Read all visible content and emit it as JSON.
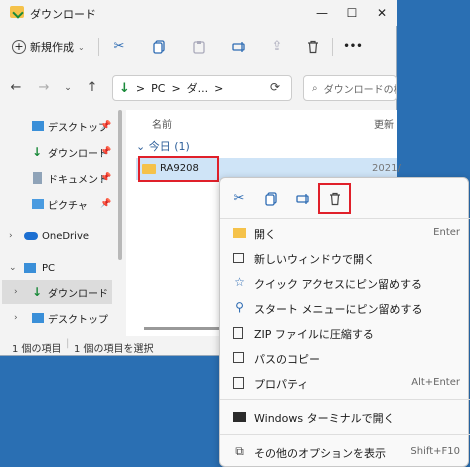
{
  "window": {
    "title": "ダウンロード",
    "controls": {
      "minimize": "—",
      "maximize": "☐",
      "close": "✕"
    }
  },
  "commandbar": {
    "new_label": "新規作成",
    "more": "•••"
  },
  "address": {
    "segments": [
      "PC",
      "ダ..."
    ],
    "sep": ">",
    "search_placeholder": "ダウンロードの検"
  },
  "sidebar": {
    "items": [
      {
        "label": "デスクトップ"
      },
      {
        "label": "ダウンロード"
      },
      {
        "label": "ドキュメント"
      },
      {
        "label": "ピクチャ"
      },
      {
        "label": "OneDrive"
      },
      {
        "label": "PC"
      },
      {
        "label": "ダウンロード"
      },
      {
        "label": "デスクトップ"
      }
    ]
  },
  "content": {
    "col_name": "名前",
    "col_date": "更新",
    "group": "今日 (1)",
    "file_name": "RA9208",
    "file_date": "2021/"
  },
  "status": {
    "count": "1 個の項目",
    "selected": "1 個の項目を選択"
  },
  "context_menu": {
    "items": [
      {
        "label": "開く",
        "shortcut": "Enter"
      },
      {
        "label": "新しいウィンドウで開く",
        "shortcut": ""
      },
      {
        "label": "クイック アクセスにピン留めする",
        "shortcut": ""
      },
      {
        "label": "スタート メニューにピン留めする",
        "shortcut": ""
      },
      {
        "label": "ZIP ファイルに圧縮する",
        "shortcut": ""
      },
      {
        "label": "パスのコピー",
        "shortcut": ""
      },
      {
        "label": "プロパティ",
        "shortcut": "Alt+Enter"
      },
      {
        "label": "Windows ターミナルで開く",
        "shortcut": ""
      },
      {
        "label": "その他のオプションを表示",
        "shortcut": "Shift+F10"
      }
    ]
  },
  "colors": {
    "accent": "#2d6bb3",
    "highlight": "#e0202a",
    "selection": "#cfe4f7"
  }
}
